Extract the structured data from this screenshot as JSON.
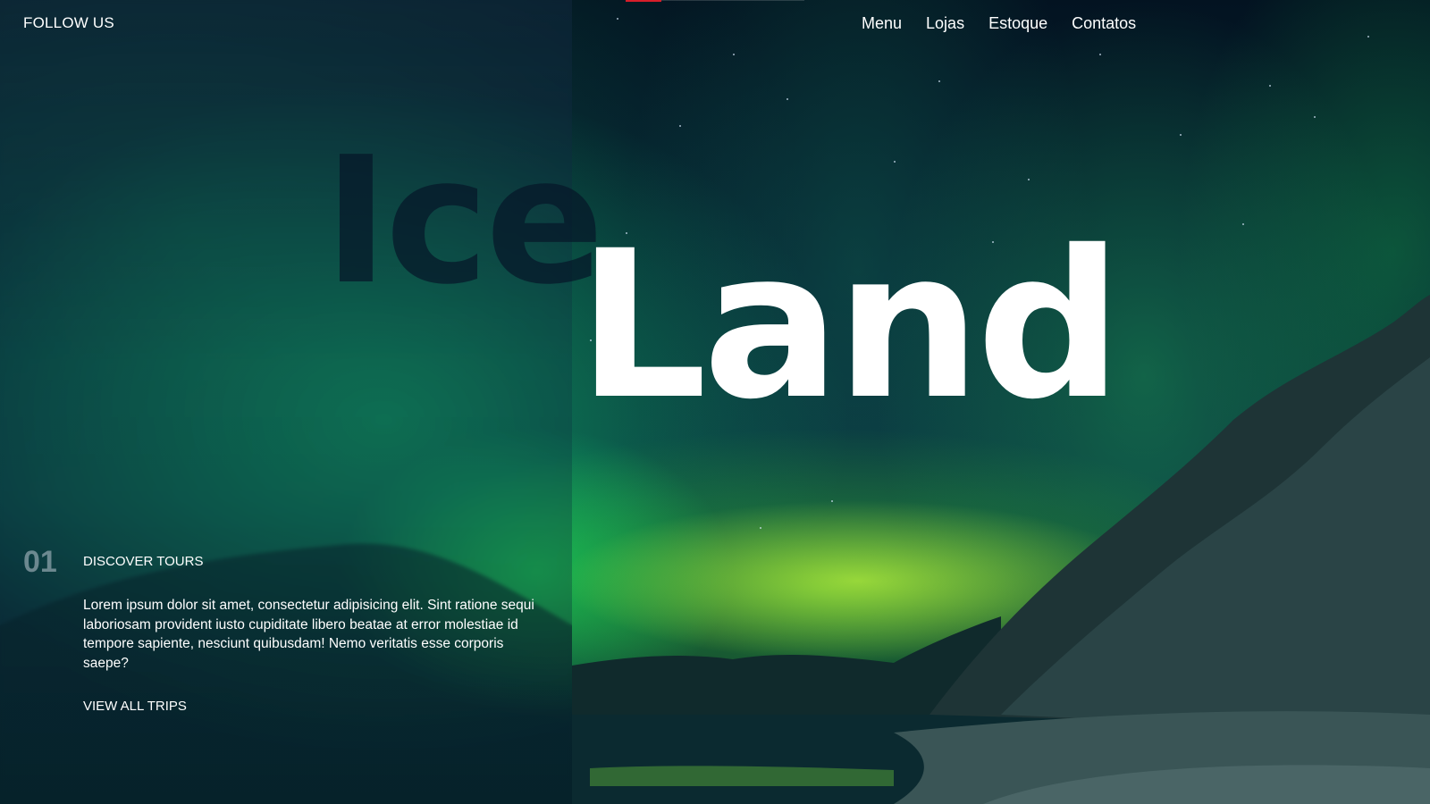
{
  "header": {
    "follow_label": "FOLLOW US",
    "nav": [
      {
        "label": "Menu"
      },
      {
        "label": "Lojas"
      },
      {
        "label": "Estoque"
      },
      {
        "label": "Contatos"
      }
    ]
  },
  "hero": {
    "title_part1": "Ice",
    "title_part2": "Land"
  },
  "tour": {
    "number": "01",
    "title": "DISCOVER TOURS",
    "description": "Lorem ipsum dolor sit amet, consectetur adipisicing elit. Sint ratione sequi laboriosam provident iusto cupiditate libero beatae at error molestiae id tempore sapiente, nesciunt quibusdam! Nemo veritatis esse corporis saepe?",
    "link_label": "VIEW ALL TRIPS"
  },
  "colors": {
    "accent": "#d81e2a",
    "aurora_green": "#22c46a",
    "text": "#ffffff"
  },
  "background": {
    "scene": "aurora-mountains"
  }
}
